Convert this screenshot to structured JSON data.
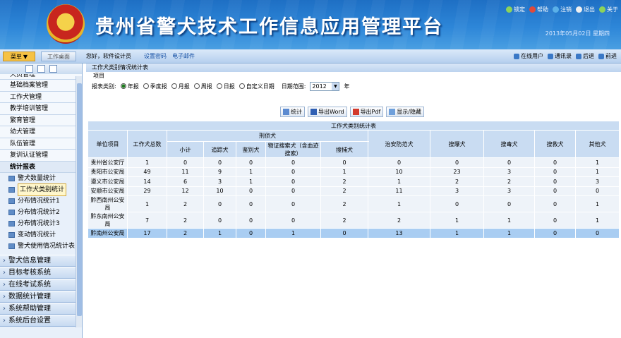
{
  "header": {
    "title": "贵州省警犬技术工作信息应用管理平台",
    "date": "2013年05月02日 星期四",
    "tools": [
      "锁定",
      "帮助",
      "注销",
      "退出",
      "关于"
    ]
  },
  "menubar": {
    "menu_label": "菜单",
    "work_label": "工作桌面",
    "greeting": "您好，软件设计员",
    "change_password": "设置密码",
    "email": "电子邮件",
    "right_tools": [
      "在线用户",
      "通讯录",
      "后退",
      "前进"
    ]
  },
  "sidebar": {
    "items": [
      "犬员管理",
      "基础档案管理",
      "工作犬管理",
      "教学培训管理",
      "繁育管理",
      "幼犬管理",
      "队伍管理",
      "复训认证管理"
    ],
    "stat_head": "统计报表",
    "sub": [
      "警犬数量统计",
      "工作犬类别统计",
      "分布情况统计1",
      "分布情况统计2",
      "分布情况统计3",
      "变动情况统计",
      "警犬使用情况统计表"
    ],
    "groups": [
      "警犬信息管理",
      "目标考核系统",
      "在线考试系统",
      "数据统计管理",
      "系统帮助管理",
      "系统后台设置"
    ]
  },
  "main": {
    "breadcrumb": "工作犬类别情况统计表",
    "section": "项目",
    "filter_label": "报表类别:",
    "radios": [
      "年报",
      "季度报",
      "月报",
      "周报",
      "日报",
      "自定义日期"
    ],
    "range_label": "日期范围:",
    "year_value": "2012",
    "year_unit": "年",
    "buttons": [
      "统计",
      "导出Word",
      "导出Pdf",
      "显示/隐藏"
    ],
    "table_title": "工作犬类别统计表",
    "headers": {
      "unit": "单位项目",
      "total": "工作犬总数",
      "criminal": "刑侦犬",
      "subtotal": "小计",
      "tracking": "追踪犬",
      "identify": "鉴别犬",
      "evidence": "物证搜索犬（含血迹搜索）",
      "capture": "搜捕犬",
      "security": "治安防范犬",
      "explosive": "搜爆犬",
      "drug": "搜毒犬",
      "rescue": "搜救犬",
      "other": "其他犬"
    },
    "rows": [
      [
        "贵州省公安厅",
        "1",
        "0",
        "0",
        "0",
        "0",
        "0",
        "0",
        "0",
        "0",
        "0",
        "1"
      ],
      [
        "贵阳市公安局",
        "49",
        "11",
        "9",
        "1",
        "0",
        "1",
        "10",
        "23",
        "3",
        "0",
        "1"
      ],
      [
        "遵义市公安局",
        "14",
        "6",
        "3",
        "1",
        "0",
        "2",
        "1",
        "2",
        "2",
        "0",
        "3"
      ],
      [
        "安顺市公安局",
        "29",
        "12",
        "10",
        "0",
        "0",
        "2",
        "11",
        "3",
        "3",
        "0",
        "0"
      ],
      [
        "黔西南州公安局",
        "1",
        "2",
        "0",
        "0",
        "0",
        "2",
        "1",
        "0",
        "0",
        "0",
        "1"
      ],
      [
        "黔东南州公安局",
        "7",
        "2",
        "0",
        "0",
        "0",
        "2",
        "2",
        "1",
        "1",
        "0",
        "1"
      ],
      [
        "黔南州公安局",
        "17",
        "2",
        "1",
        "0",
        "1",
        "0",
        "13",
        "1",
        "1",
        "0",
        "0"
      ]
    ]
  }
}
